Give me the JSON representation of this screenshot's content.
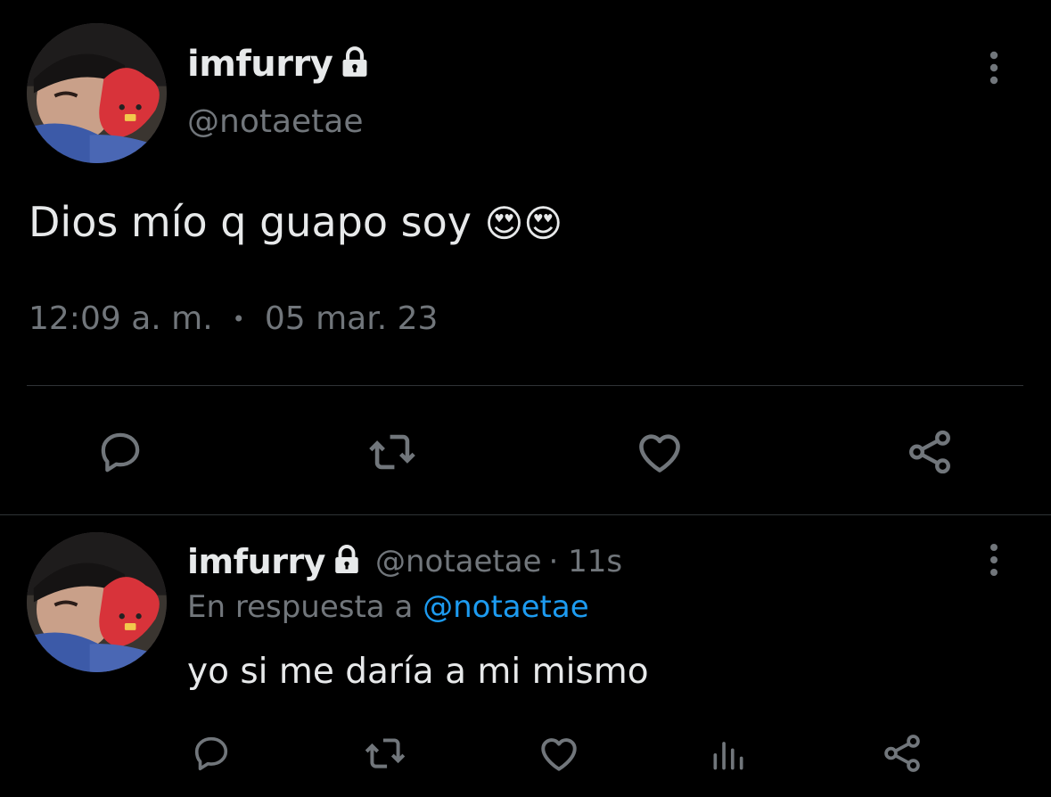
{
  "main_tweet": {
    "display_name": "imfurry",
    "handle": "@notaetae",
    "text": "Dios mío q guapo soy",
    "emoji": "😍😍",
    "time": "12:09 a. m.",
    "separator": "•",
    "date": "05 mar. 23"
  },
  "reply_tweet": {
    "display_name": "imfurry",
    "handle": "@notaetae",
    "age": "· 11s",
    "reply_prefix": "En respuesta a",
    "reply_mention": "@notaetae",
    "text": "yo si me daría a mi mismo"
  },
  "icons": {
    "lock": "lock-icon",
    "more": "more-vertical-icon",
    "reply": "reply-icon",
    "retweet": "retweet-icon",
    "like": "heart-icon",
    "share": "share-icon",
    "views": "views-icon"
  },
  "colors": {
    "background": "#000000",
    "text": "#e7e9ea",
    "muted": "#71767b",
    "accent": "#1d9bf0",
    "divider": "#2f3336"
  }
}
